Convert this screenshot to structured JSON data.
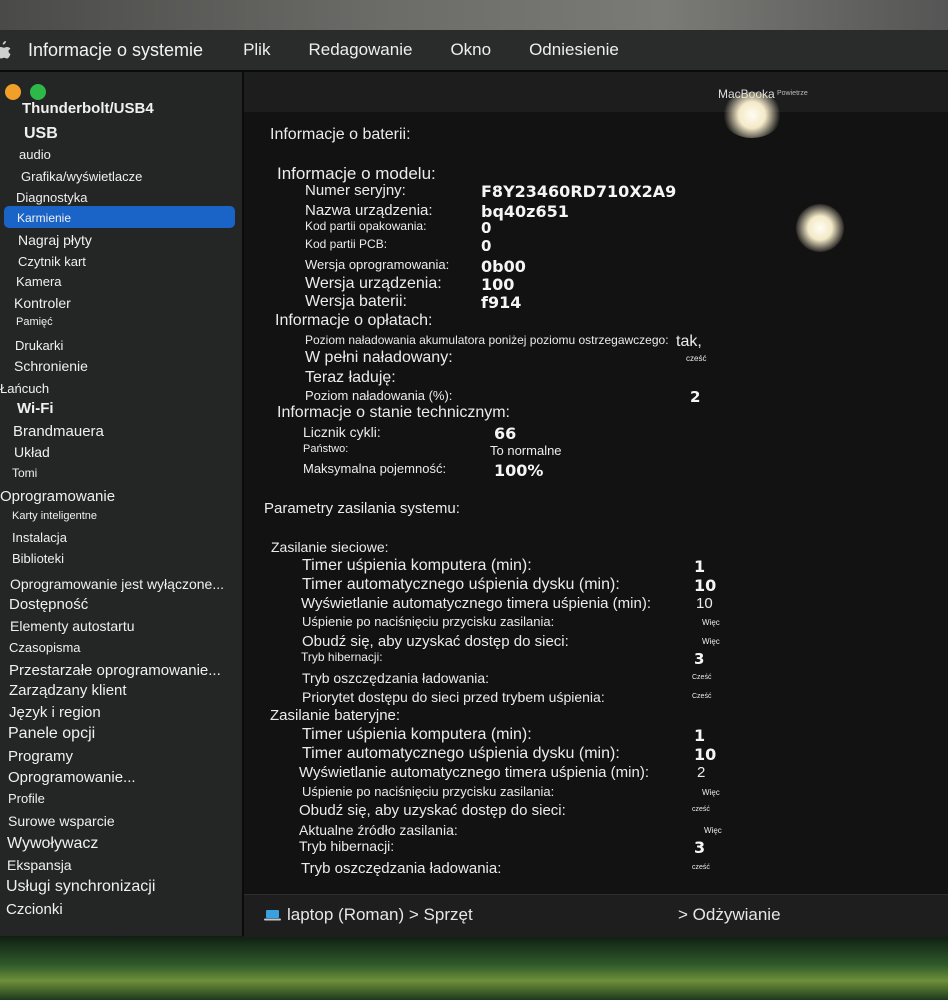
{
  "menubar": {
    "app": "Informacje o systemie",
    "items": [
      "Plik",
      "Redagowanie",
      "Okno",
      "Odniesienie"
    ]
  },
  "window": {
    "title": "MacBooka",
    "subtitle": "Powietrze"
  },
  "sidebar": {
    "selected": "Karmienie",
    "items": [
      {
        "label": "Thunderbolt/USB4"
      },
      {
        "label": "USB"
      },
      {
        "label": "audio"
      },
      {
        "label": "Grafika/wyświetlacze"
      },
      {
        "label": "Diagnostyka"
      },
      {
        "label": "Karmienie"
      },
      {
        "label": "Nagraj płyty"
      },
      {
        "label": "Czytnik kart"
      },
      {
        "label": "Kamera"
      },
      {
        "label": "Kontroler"
      },
      {
        "label": "Pamięć"
      },
      {
        "label": "Drukarki"
      },
      {
        "label": "Schronienie"
      },
      {
        "label": "Łańcuch"
      },
      {
        "label": "Wi-Fi"
      },
      {
        "label": "Brandmauera"
      },
      {
        "label": "Układ"
      },
      {
        "label": "Tomi"
      },
      {
        "label": "Oprogramowanie"
      },
      {
        "label": "Karty inteligentne"
      },
      {
        "label": "Instalacja"
      },
      {
        "label": "Biblioteki"
      },
      {
        "label": "Oprogramowanie jest wyłączone..."
      },
      {
        "label": "Dostępność"
      },
      {
        "label": "Elementy autostartu"
      },
      {
        "label": "Czasopisma"
      },
      {
        "label": "Przestarzałe oprogramowanie..."
      },
      {
        "label": "Zarządzany klient"
      },
      {
        "label": "Język i region"
      },
      {
        "label": "Panele opcji"
      },
      {
        "label": "Programy"
      },
      {
        "label": "Oprogramowanie..."
      },
      {
        "label": "Profile"
      },
      {
        "label": "Surowe wsparcie"
      },
      {
        "label": "Wywoływacz"
      },
      {
        "label": "Ekspansja"
      },
      {
        "label": "Usługi synchronizacji"
      },
      {
        "label": "Czcionki"
      }
    ]
  },
  "battery": {
    "heading": "Informacje o baterii:",
    "model_heading": "Informacje o modelu:",
    "model": [
      {
        "label": "Numer seryjny:",
        "value": "F8Y23460RD710X2A9"
      },
      {
        "label": "Nazwa urządzenia:",
        "value": "bq40z651"
      },
      {
        "label": "Kod partii opakowania:",
        "value": "0"
      },
      {
        "label": "Kod partii PCB:",
        "value": "0"
      },
      {
        "label": "Wersja oprogramowania:",
        "value": "0b00"
      },
      {
        "label": "Wersja urządzenia:",
        "value": "100"
      },
      {
        "label": "Wersja baterii:",
        "value": "f914"
      }
    ],
    "charge_heading": "Informacje o opłatach:",
    "charge": [
      {
        "label": "Poziom naładowania akumulatora poniżej poziomu ostrzegawczego:",
        "value": "tak,"
      },
      {
        "label": "W pełni naładowany:",
        "value": "cześć"
      },
      {
        "label": "Teraz ładuję:",
        "value": ""
      },
      {
        "label": "Poziom naładowania (%):",
        "value": "2"
      }
    ],
    "health_heading": "Informacje o stanie technicznym:",
    "health": [
      {
        "label": "Licznik cykli:",
        "value": "66"
      },
      {
        "label": "Państwo:",
        "value": "To normalne"
      },
      {
        "label": "Maksymalna pojemność:",
        "value": "100%"
      }
    ]
  },
  "power": {
    "heading": "Parametry zasilania systemu:",
    "ac_heading": "Zasilanie sieciowe:",
    "ac": [
      {
        "label": "Timer uśpienia komputera (min):",
        "value": "1"
      },
      {
        "label": "Timer automatycznego uśpienia dysku (min):",
        "value": "10"
      },
      {
        "label": "Wyświetlanie automatycznego timera uśpienia (min):",
        "value": "10"
      },
      {
        "label": "Uśpienie po naciśnięciu przycisku zasilania:",
        "value": "Więc"
      },
      {
        "label": "Obudź się, aby uzyskać dostęp do sieci:",
        "value": "Więc"
      },
      {
        "label": "Tryb hibernacji:",
        "value": "3"
      },
      {
        "label": "Tryb oszczędzania ładowania:",
        "value": "Cześć"
      },
      {
        "label": "Priorytet dostępu do sieci przed trybem uśpienia:",
        "value": "Cześć"
      }
    ],
    "bat_heading": "Zasilanie bateryjne:",
    "bat": [
      {
        "label": "Timer uśpienia komputera (min):",
        "value": "1"
      },
      {
        "label": "Timer automatycznego uśpienia dysku (min):",
        "value": "10"
      },
      {
        "label": "Wyświetlanie automatycznego timera uśpienia (min):",
        "value": "2"
      },
      {
        "label": "Uśpienie po naciśnięciu przycisku zasilania:",
        "value": "Więc"
      },
      {
        "label": "Obudź się, aby uzyskać dostęp do sieci:",
        "value": "cześć"
      },
      {
        "label": "Aktualne źródło zasilania:",
        "value": "Więc"
      },
      {
        "label": "Tryb hibernacji:",
        "value": "3"
      },
      {
        "label": "Tryb oszczędzania ładowania:",
        "value": "cześć"
      }
    ]
  },
  "footer": {
    "path": "laptop (Roman) > Sprzęt",
    "section": "> Odżywianie"
  },
  "colors": {
    "selection": "#1a64c8",
    "close": "#f0a028",
    "zoom": "#2fb84a"
  }
}
